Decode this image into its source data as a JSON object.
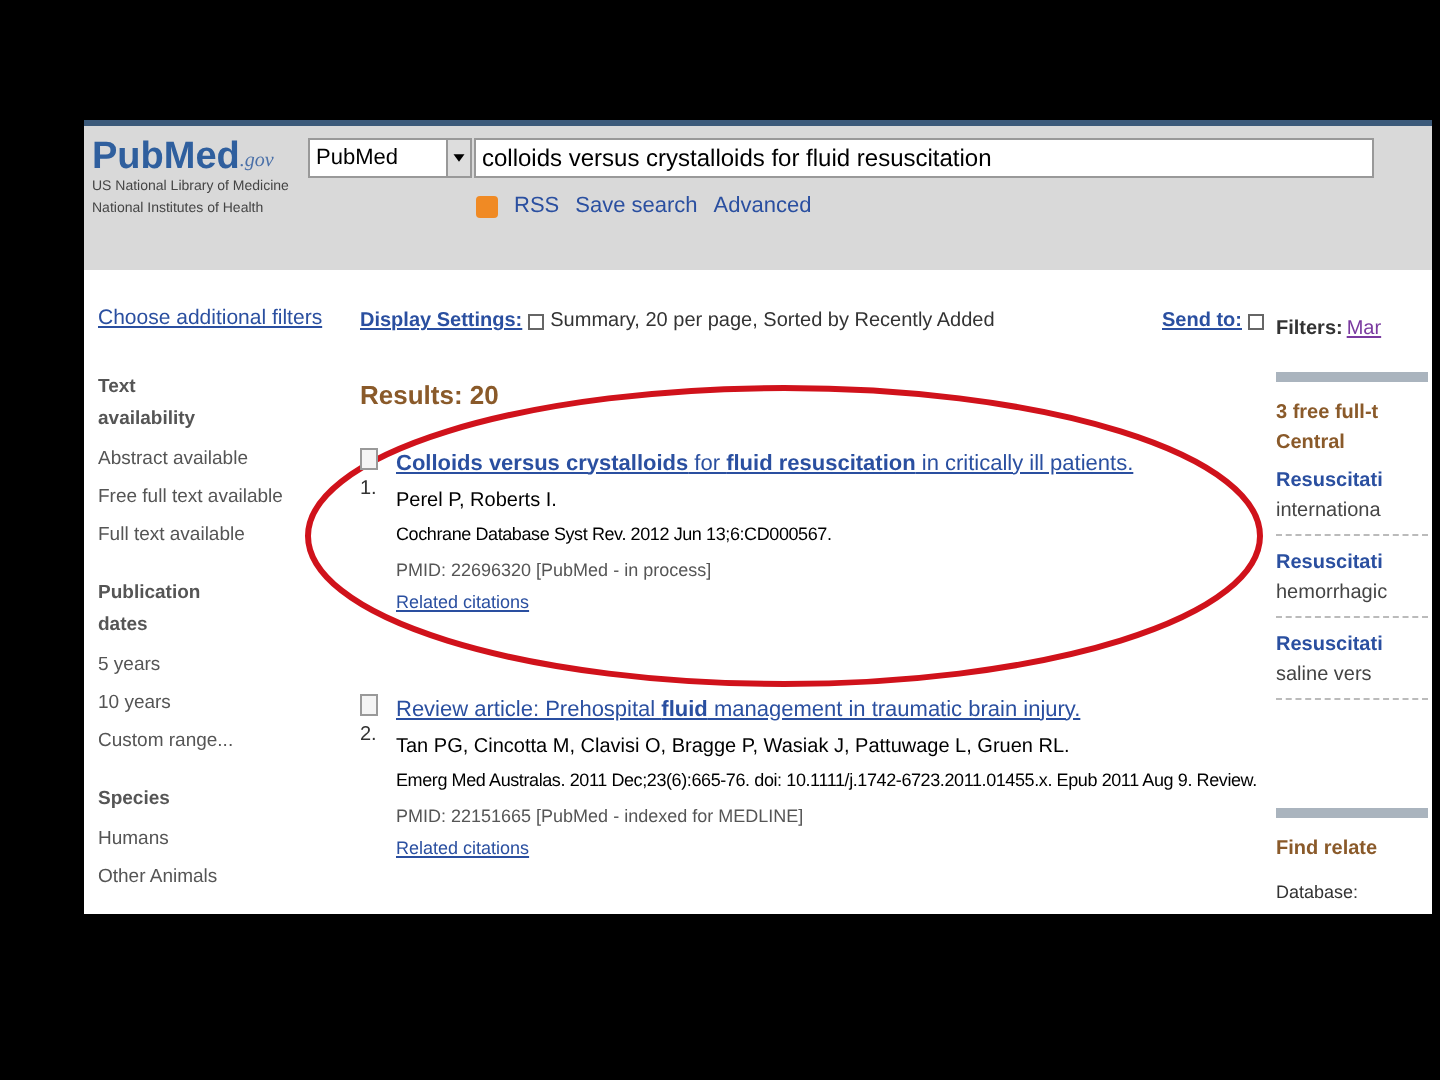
{
  "header": {
    "logo": "PubMed",
    "logo_suffix": ".gov",
    "institution": [
      "US National Library of Medicine",
      "National Institutes of Health"
    ],
    "database_select": "PubMed",
    "search_value": "colloids versus crystalloids for fluid resuscitation",
    "links": [
      "RSS",
      "Save search",
      "Advanced"
    ]
  },
  "sidebar": {
    "filters_link": "Choose additional filters",
    "groups": [
      {
        "title": "Text availability",
        "items": [
          "Abstract available",
          "Free full text available",
          "Full text available"
        ]
      },
      {
        "title": "Publication dates",
        "items": [
          "5 years",
          "10 years",
          "Custom range..."
        ]
      },
      {
        "title": "Species",
        "items": [
          "Humans",
          "Other Animals"
        ]
      }
    ]
  },
  "display_settings": {
    "label": "Display Settings:",
    "value": "Summary, 20 per page, Sorted by Recently Added",
    "send_to": "Send to:"
  },
  "results_count": "Results: 20",
  "results": [
    {
      "number": "1.",
      "checked": false,
      "title": "**Colloids versus crystalloids** for **fluid resuscitation** in critically ill patients.",
      "authors": "Perel P, Roberts I.",
      "citation": "Cochrane Database Syst Rev. 2012 Jun 13;6:CD000567.",
      "pmid": "PMID: 22696320 [PubMed - in process]",
      "related": "Related citations"
    },
    {
      "number": "2.",
      "checked": false,
      "title": "Review article: Prehospital **fluid** management in traumatic brain injury.",
      "authors": "Tan PG, Cincotta M, Clavisi O, Bragge P, Wasiak J, Pattuwage L, Gruen RL.",
      "citation": "Emerg Med Australas. 2011 Dec;23(6):665-76. doi: 10.1111/j.1742-6723.2011.01455.x. Epub 2011 Aug 9. Review.",
      "pmid": "PMID: 22151665 [PubMed - indexed for MEDLINE]",
      "related": "Related citations"
    }
  ],
  "right_panel": {
    "filters_label": "Filters:",
    "filters_link": "Mar",
    "free_heading": "3 free full-t",
    "free_heading_2": "Central",
    "items": [
      {
        "title": "Resuscitati",
        "snippet": "internationa"
      },
      {
        "title": "Resuscitati",
        "snippet": "hemorrhagic"
      },
      {
        "title": "Resuscitati",
        "snippet": "saline vers"
      }
    ],
    "find_related": "Find relate",
    "database_label": "Database:"
  }
}
